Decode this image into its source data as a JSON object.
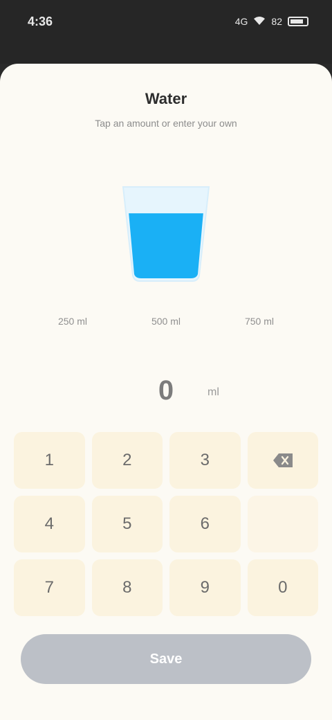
{
  "status_bar": {
    "time": "4:36",
    "signal": "4G",
    "battery": "82"
  },
  "header": {
    "title": "Water",
    "subtitle": "Tap an amount or enter your own"
  },
  "cup": {
    "fill_fraction": 0.72,
    "fill_color": "#1ab0f5"
  },
  "presets": [
    {
      "label": "250 ml"
    },
    {
      "label": "500 ml"
    },
    {
      "label": "750 ml"
    }
  ],
  "amount": {
    "value": "0",
    "unit": "ml"
  },
  "keypad": {
    "keys": [
      "1",
      "2",
      "3",
      "",
      "4",
      "5",
      "6",
      "",
      "7",
      "8",
      "9",
      "0"
    ]
  },
  "save_button": {
    "label": "Save"
  },
  "colors": {
    "accent": "#1ab0f5",
    "key_background": "#fbf3df",
    "button_disabled": "#bcc0c7"
  }
}
